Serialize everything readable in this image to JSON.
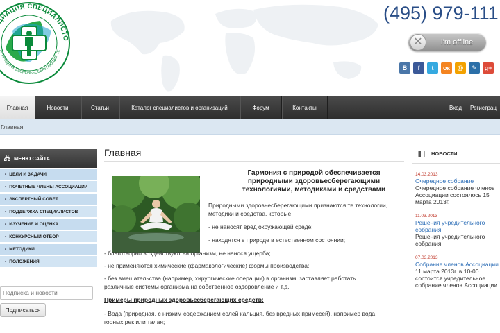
{
  "header": {
    "logo_ring_text": "АССОЦИАЦИЯ СПЕЦИАЛИСТОВ",
    "logo_bottom_text": "ПРИРОДНЫХ ЗДОРОВЬЕСБЕРЕГАЮЩИХ ТЕХНОЛОГИЙ",
    "phone": "(495) 979-111",
    "offline_label": "I'm offline",
    "socials": [
      {
        "name": "vkontakte-icon",
        "glyph": "B",
        "color": "#4a76a8"
      },
      {
        "name": "facebook-icon",
        "glyph": "f",
        "color": "#3b5998"
      },
      {
        "name": "twitter-icon",
        "glyph": "t",
        "color": "#35a9e0"
      },
      {
        "name": "odnoklassniki-icon",
        "glyph": "ок",
        "color": "#f48420"
      },
      {
        "name": "mail-icon",
        "glyph": "@",
        "color": "#f3a200"
      },
      {
        "name": "livejournal-icon",
        "glyph": "✎",
        "color": "#2b6fa8"
      },
      {
        "name": "google-plus-icon",
        "glyph": "g+",
        "color": "#dd4b39"
      }
    ]
  },
  "nav": {
    "items": [
      "Главная",
      "Новости",
      "Статьи",
      "Каталог специалистов и организаций",
      "Форум",
      "Контакты"
    ],
    "login": "Вход",
    "register": "Регистрац"
  },
  "breadcrumb": "Главная",
  "sidebar": {
    "title": "МЕНЮ САЙТА",
    "items": [
      "ЦЕЛИ И ЗАДАЧИ",
      "ПОЧЕТНЫЕ ЧЛЕНЫ АССОЦИАЦИИ",
      "ЭКСПЕРТНЫЙ СОВЕТ",
      "ПОДДЕРЖКА СПЕЦИАЛИСТОВ",
      "ИЗУЧЕНИЕ И ОЦЕНКА",
      "КОНКУРСНЫЙ ОТБОР",
      "МЕТОДИКИ",
      "ПОЛОЖЕНИЯ"
    ],
    "subscribe_placeholder": "Подписка и новости",
    "subscribe_button": "Подписаться"
  },
  "main": {
    "title": "Главная",
    "article_title": "Гармония с природой обеспечивается природными здоровьесберегающими технологиями, методиками и средствами",
    "intro": "Природными здоровьесберегающими признаются те технологии, методики и средства, которые:",
    "bullets": [
      "- не наносят вред окружающей среде;",
      "- находятся в природе в естественном состоянии;",
      "- благотворно воздействуют на организм, не нанося ущерба;",
      "- не применяются химические (фармакологические) формы производства;",
      "- без вмешательства (например, хирургические операции) в организм, заставляет работать различные системы организма на собственное оздоровление и т.д."
    ],
    "examples_title": "Примеры природных здоровьесберегающих средств:",
    "example_1": "- Вода (природная, с низким содержанием солей кальция, без вредных примесей), например вода горных рек или талая;"
  },
  "news": {
    "title": "НОВОСТИ",
    "items": [
      {
        "date": "14.03.2013",
        "link": "Очередное собрание",
        "text": "Очередное собрание членов Ассоциации состоялось 15 марта 2013г."
      },
      {
        "date": "11.03.2013",
        "link": "Решения учредительного собрания",
        "text": "Решения учредительного собрания"
      },
      {
        "date": "07.03.2013",
        "link": "Собрание членов Ассоциации",
        "text": "11 марта 2013г. в 10-00 состоится учредительное собрание членов Ассоциации."
      }
    ]
  }
}
